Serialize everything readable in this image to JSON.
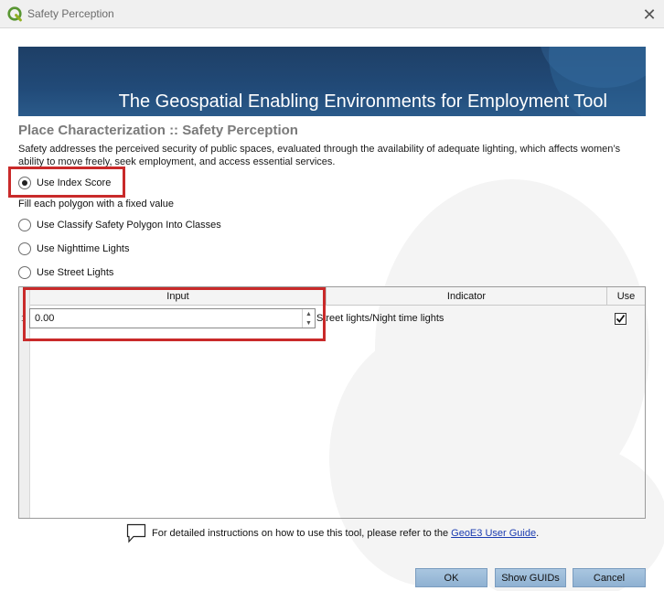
{
  "window": {
    "title": "Safety Perception",
    "app_icon": "qgis-icon",
    "close_icon": "close-icon"
  },
  "banner": {
    "title": "The Geospatial Enabling Environments for Employment Tool"
  },
  "section": {
    "title": "Place Characterization :: Safety Perception",
    "description": "Safety addresses the perceived security of public spaces, evaluated through the availability of adequate lighting, which affects women’s ability to move freely, seek employment, and access essential services."
  },
  "options": [
    {
      "label": "Use Index Score",
      "checked": true
    },
    {
      "label": "Use Classify Safety Polygon Into Classes",
      "checked": false
    },
    {
      "label": "Use Nighttime Lights",
      "checked": false
    },
    {
      "label": "Use Street Lights",
      "checked": false
    }
  ],
  "hint": "Fill each polygon with a fixed value",
  "table": {
    "headers": [
      "Input",
      "Indicator",
      "Use"
    ],
    "rows": [
      {
        "num": "1",
        "input": "0.00",
        "indicator": "Street lights/Night time lights",
        "use": true
      }
    ]
  },
  "footer": {
    "prefix": "For detailed instructions on how to use this tool, please refer to the ",
    "link": "GeoE3 User Guide",
    "suffix": "."
  },
  "buttons": {
    "ok": "OK",
    "guids": "Show GUIDs",
    "cancel": "Cancel"
  },
  "colors": {
    "highlight": "#c92a2a",
    "banner": "#1e3f66",
    "button": "#9bbbd9",
    "link": "#1a3bb0"
  }
}
